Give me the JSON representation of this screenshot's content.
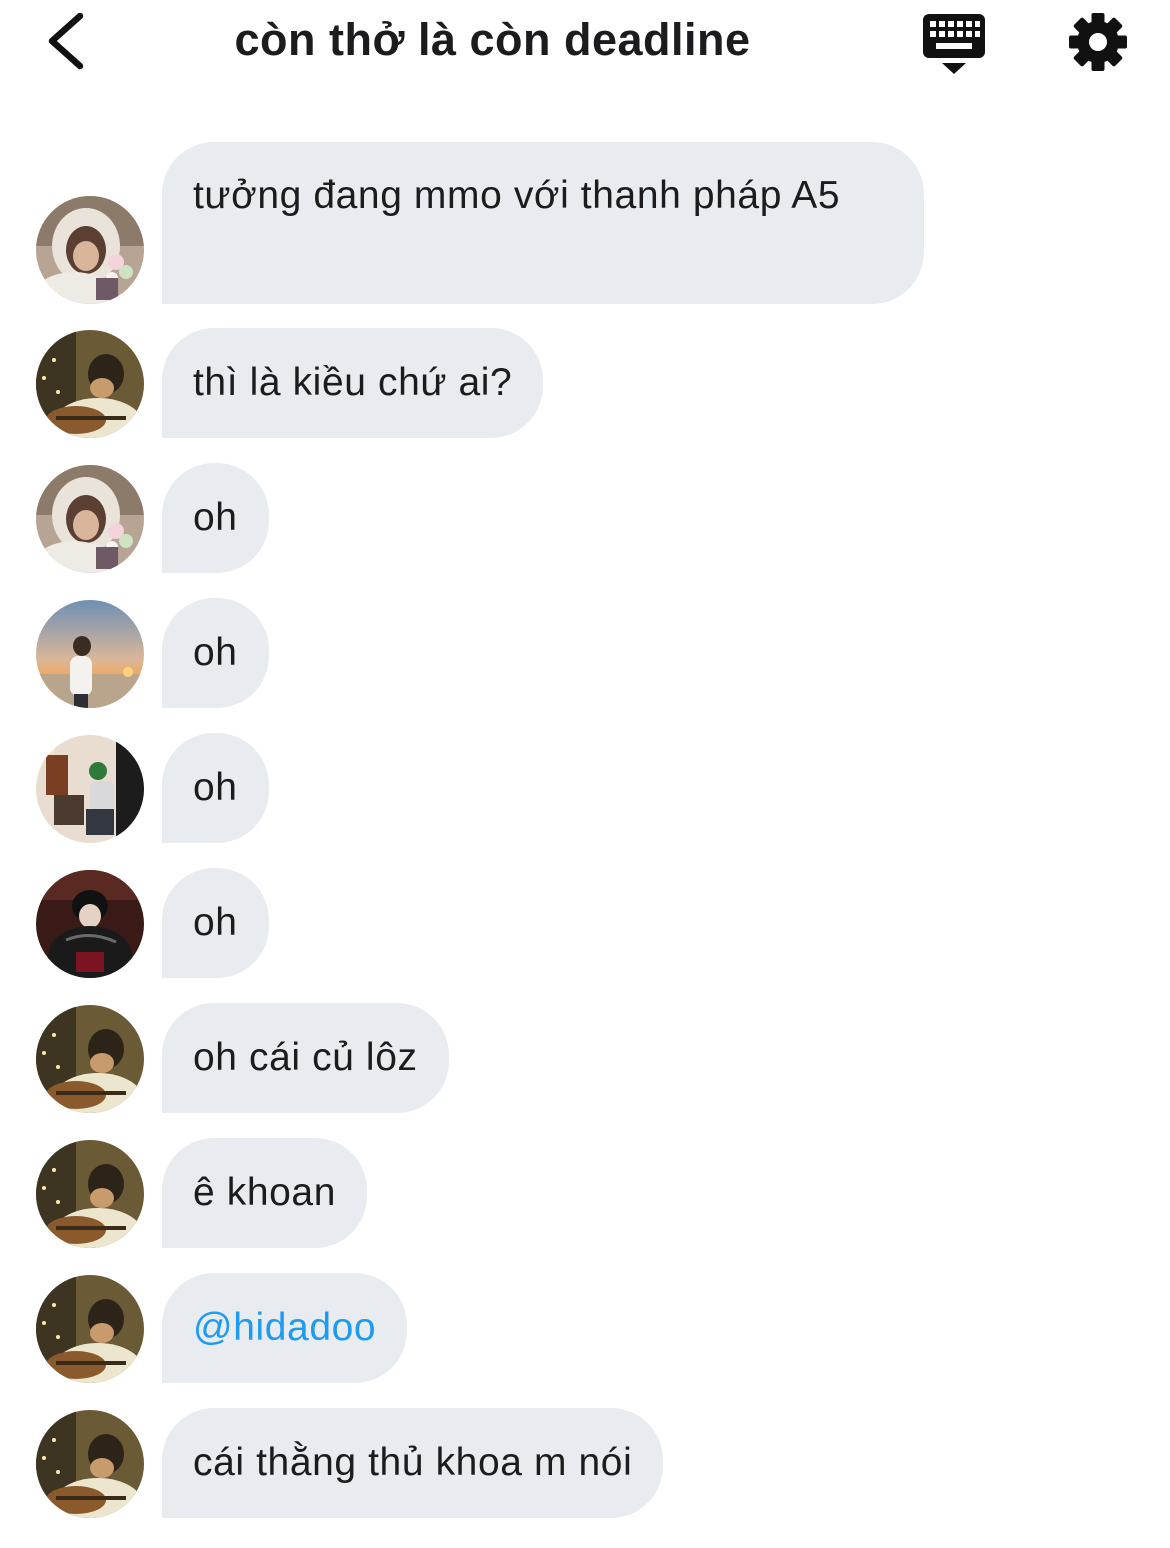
{
  "header": {
    "title": "còn thở là còn deadline"
  },
  "messages": [
    {
      "avatar": "avatar-hoodie-girl",
      "text": "tưởng đang mmo với thanh pháp A5"
    },
    {
      "avatar": "avatar-guitar-boy",
      "text": "thì là kiều chứ ai?"
    },
    {
      "avatar": "avatar-hoodie-girl",
      "text": "oh"
    },
    {
      "avatar": "avatar-sunset-boy",
      "text": "oh"
    },
    {
      "avatar": "avatar-room-boy",
      "text": "oh"
    },
    {
      "avatar": "avatar-leather-boy",
      "text": "oh"
    },
    {
      "avatar": "avatar-guitar-boy",
      "text": "oh cái củ lôz"
    },
    {
      "avatar": "avatar-guitar-boy",
      "text": "ê khoan"
    },
    {
      "avatar": "avatar-guitar-boy",
      "text": "@hidadoo"
    },
    {
      "avatar": "avatar-guitar-boy",
      "text": "cái thằng thủ khoa m nói"
    }
  ],
  "colors": {
    "bubble": "#e8ebef",
    "mention": "#1d9bf0",
    "text": "#1c1c1e"
  }
}
